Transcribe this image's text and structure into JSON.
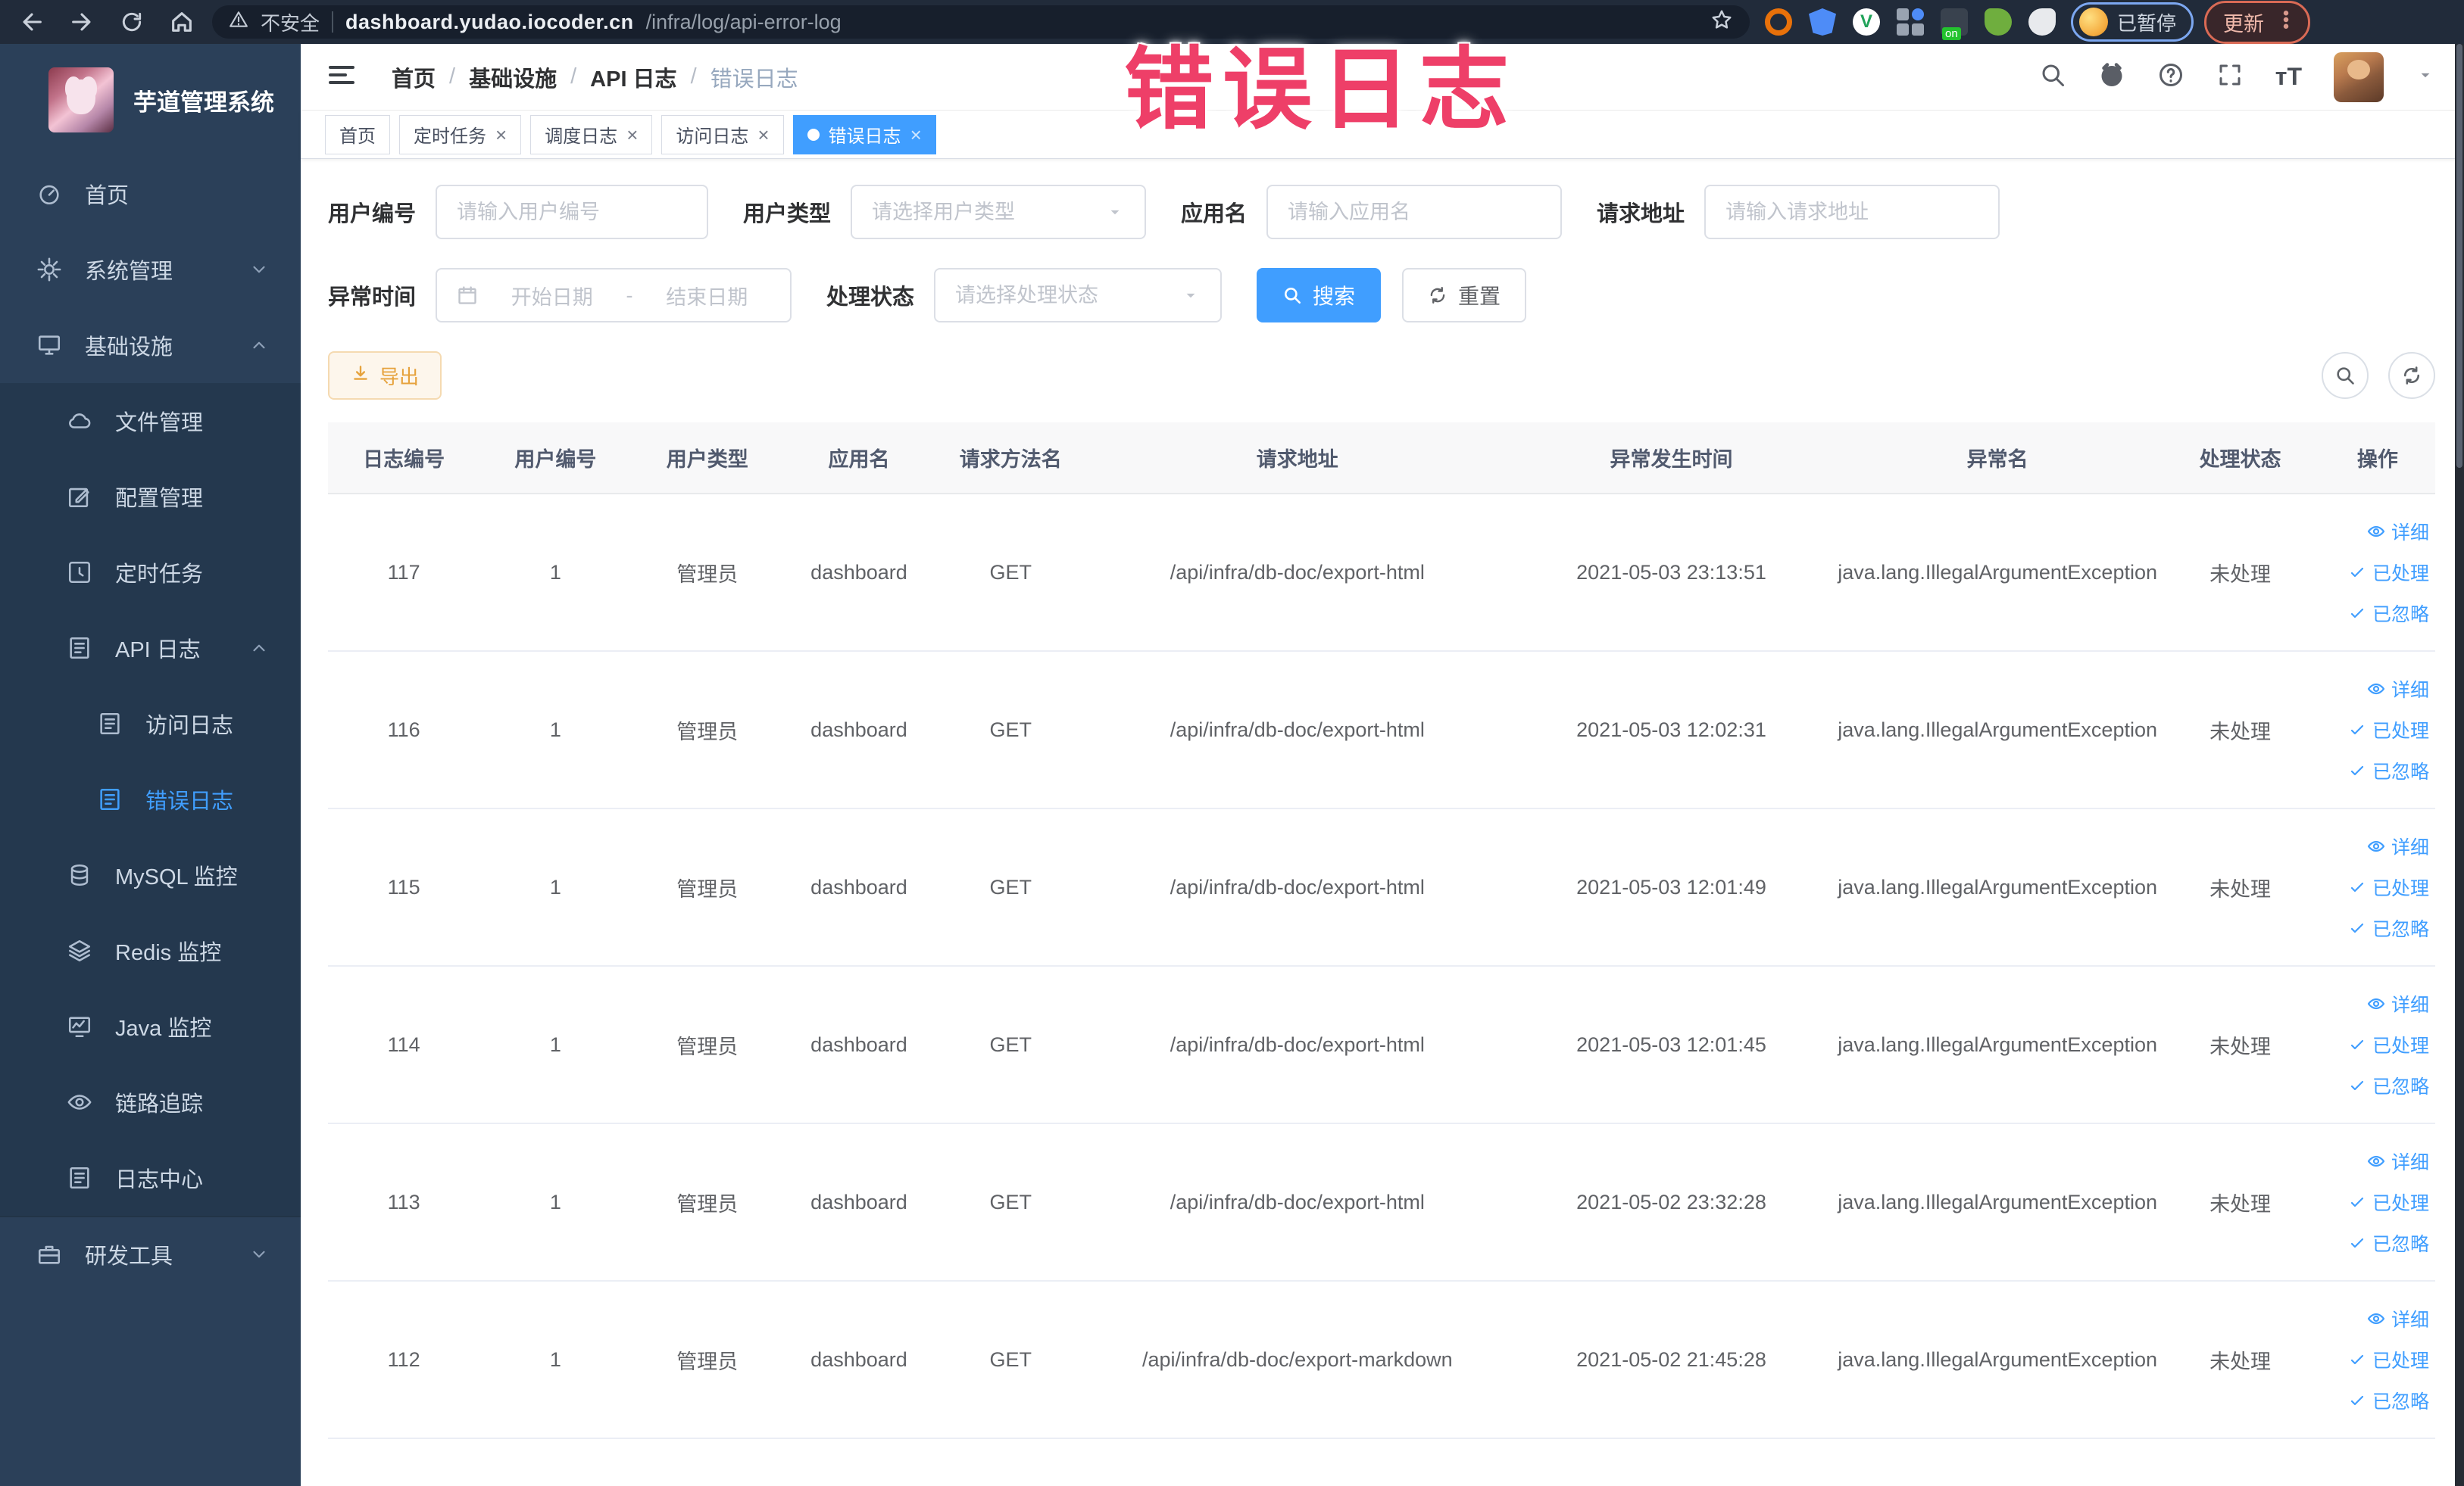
{
  "colors": {
    "accent": "#409eff",
    "warning": "#e6a23c",
    "overlay_pink": "#ee3f68",
    "sidebar_bg": "#2b4059",
    "submenu_bg": "#24384e"
  },
  "browser": {
    "security_label": "不安全",
    "url_host": "dashboard.yudao.iocoder.cn",
    "url_path": "/infra/log/api-error-log",
    "paused_label": "已暂停",
    "update_label": "更新",
    "extensions": [
      "orange-circle-extension",
      "blue-shield-extension",
      "green-v-extension",
      "grid-extension",
      "on-badge-extension",
      "green-leaf-extension",
      "puzzle-extension"
    ]
  },
  "sidebar": {
    "logo_title": "芋道管理系统",
    "menu": [
      {
        "label": "首页",
        "icon": "dashboard-icon",
        "level": 0
      },
      {
        "label": "系统管理",
        "icon": "gear-icon",
        "level": 0,
        "chevron": "down"
      },
      {
        "label": "基础设施",
        "icon": "monitor-icon",
        "level": 0,
        "chevron": "up"
      },
      {
        "label": "文件管理",
        "icon": "cloud-icon",
        "level": 1
      },
      {
        "label": "配置管理",
        "icon": "edit-icon",
        "level": 1
      },
      {
        "label": "定时任务",
        "icon": "clock-icon",
        "level": 1
      },
      {
        "label": "API 日志",
        "icon": "log-icon",
        "level": 1,
        "chevron": "up"
      },
      {
        "label": "访问日志",
        "icon": "log-icon",
        "level": 2
      },
      {
        "label": "错误日志",
        "icon": "log-icon",
        "level": 2,
        "active": true
      },
      {
        "label": "MySQL 监控",
        "icon": "database-icon",
        "level": 1
      },
      {
        "label": "Redis 监控",
        "icon": "layers-icon",
        "level": 1
      },
      {
        "label": "Java 监控",
        "icon": "java-icon",
        "level": 1
      },
      {
        "label": "链路追踪",
        "icon": "eye-icon",
        "level": 1
      },
      {
        "label": "日志中心",
        "icon": "log-icon",
        "level": 1
      },
      {
        "label": "研发工具",
        "icon": "briefcase-icon",
        "level": 0,
        "chevron": "down",
        "divider": true
      }
    ]
  },
  "header": {
    "breadcrumb": [
      "首页",
      "基础设施",
      "API 日志",
      "错误日志"
    ],
    "right_icons": [
      "search-icon",
      "github-icon",
      "help-icon",
      "fullscreen-icon",
      "font-size-icon"
    ]
  },
  "tags": [
    {
      "label": "首页",
      "closable": false,
      "active": false
    },
    {
      "label": "定时任务",
      "closable": true,
      "active": false
    },
    {
      "label": "调度日志",
      "closable": true,
      "active": false
    },
    {
      "label": "访问日志",
      "closable": true,
      "active": false
    },
    {
      "label": "错误日志",
      "closable": true,
      "active": true
    }
  ],
  "overlay": {
    "title": "错误日志"
  },
  "filters": {
    "fields": [
      {
        "key": "user_id",
        "label": "用户编号",
        "type": "input",
        "placeholder": "请输入用户编号",
        "row": 1,
        "width": "w-360"
      },
      {
        "key": "user_type",
        "label": "用户类型",
        "type": "select",
        "placeholder": "请选择用户类型",
        "row": 1,
        "width": "w-390"
      },
      {
        "key": "app_name",
        "label": "应用名",
        "type": "input",
        "placeholder": "请输入应用名",
        "row": 1,
        "width": "w-390"
      },
      {
        "key": "request_url",
        "label": "请求地址",
        "type": "input",
        "placeholder": "请输入请求地址",
        "row": 1,
        "width": "w-390"
      },
      {
        "key": "error_time",
        "label": "异常时间",
        "type": "daterange",
        "placeholder_start": "开始日期",
        "separator": "-",
        "placeholder_end": "结束日期",
        "row": 2,
        "width": "w-470"
      },
      {
        "key": "process_status",
        "label": "处理状态",
        "type": "select",
        "placeholder": "请选择处理状态",
        "row": 2,
        "width": "w-380"
      }
    ],
    "search_label": "搜索",
    "reset_label": "重置"
  },
  "toolbar": {
    "export_label": "导出",
    "icon_buttons": [
      "search-toggle-icon",
      "refresh-icon"
    ]
  },
  "table": {
    "columns": [
      "日志编号",
      "用户编号",
      "用户类型",
      "应用名",
      "请求方法名",
      "请求地址",
      "异常发生时间",
      "异常名",
      "处理状态",
      "操作"
    ],
    "rows": [
      {
        "id": "117",
        "user_id": "1",
        "user_type": "管理员",
        "app_name": "dashboard",
        "method": "GET",
        "url": "/api/infra/db-doc/export-html",
        "time": "2021-05-03 23:13:51",
        "exception": "java.lang.IllegalArgumentException",
        "status": "未处理"
      },
      {
        "id": "116",
        "user_id": "1",
        "user_type": "管理员",
        "app_name": "dashboard",
        "method": "GET",
        "url": "/api/infra/db-doc/export-html",
        "time": "2021-05-03 12:02:31",
        "exception": "java.lang.IllegalArgumentException",
        "status": "未处理"
      },
      {
        "id": "115",
        "user_id": "1",
        "user_type": "管理员",
        "app_name": "dashboard",
        "method": "GET",
        "url": "/api/infra/db-doc/export-html",
        "time": "2021-05-03 12:01:49",
        "exception": "java.lang.IllegalArgumentException",
        "status": "未处理"
      },
      {
        "id": "114",
        "user_id": "1",
        "user_type": "管理员",
        "app_name": "dashboard",
        "method": "GET",
        "url": "/api/infra/db-doc/export-html",
        "time": "2021-05-03 12:01:45",
        "exception": "java.lang.IllegalArgumentException",
        "status": "未处理"
      },
      {
        "id": "113",
        "user_id": "1",
        "user_type": "管理员",
        "app_name": "dashboard",
        "method": "GET",
        "url": "/api/infra/db-doc/export-html",
        "time": "2021-05-02 23:32:28",
        "exception": "java.lang.IllegalArgumentException",
        "status": "未处理"
      },
      {
        "id": "112",
        "user_id": "1",
        "user_type": "管理员",
        "app_name": "dashboard",
        "method": "GET",
        "url": "/api/infra/db-doc/export-markdown",
        "time": "2021-05-02 21:45:28",
        "exception": "java.lang.IllegalArgumentException",
        "status": "未处理"
      }
    ],
    "row_actions": [
      {
        "label": "详细",
        "icon": "eye-icon"
      },
      {
        "label": "已处理",
        "icon": "check-icon"
      },
      {
        "label": "已忽略",
        "icon": "check-icon"
      }
    ]
  }
}
